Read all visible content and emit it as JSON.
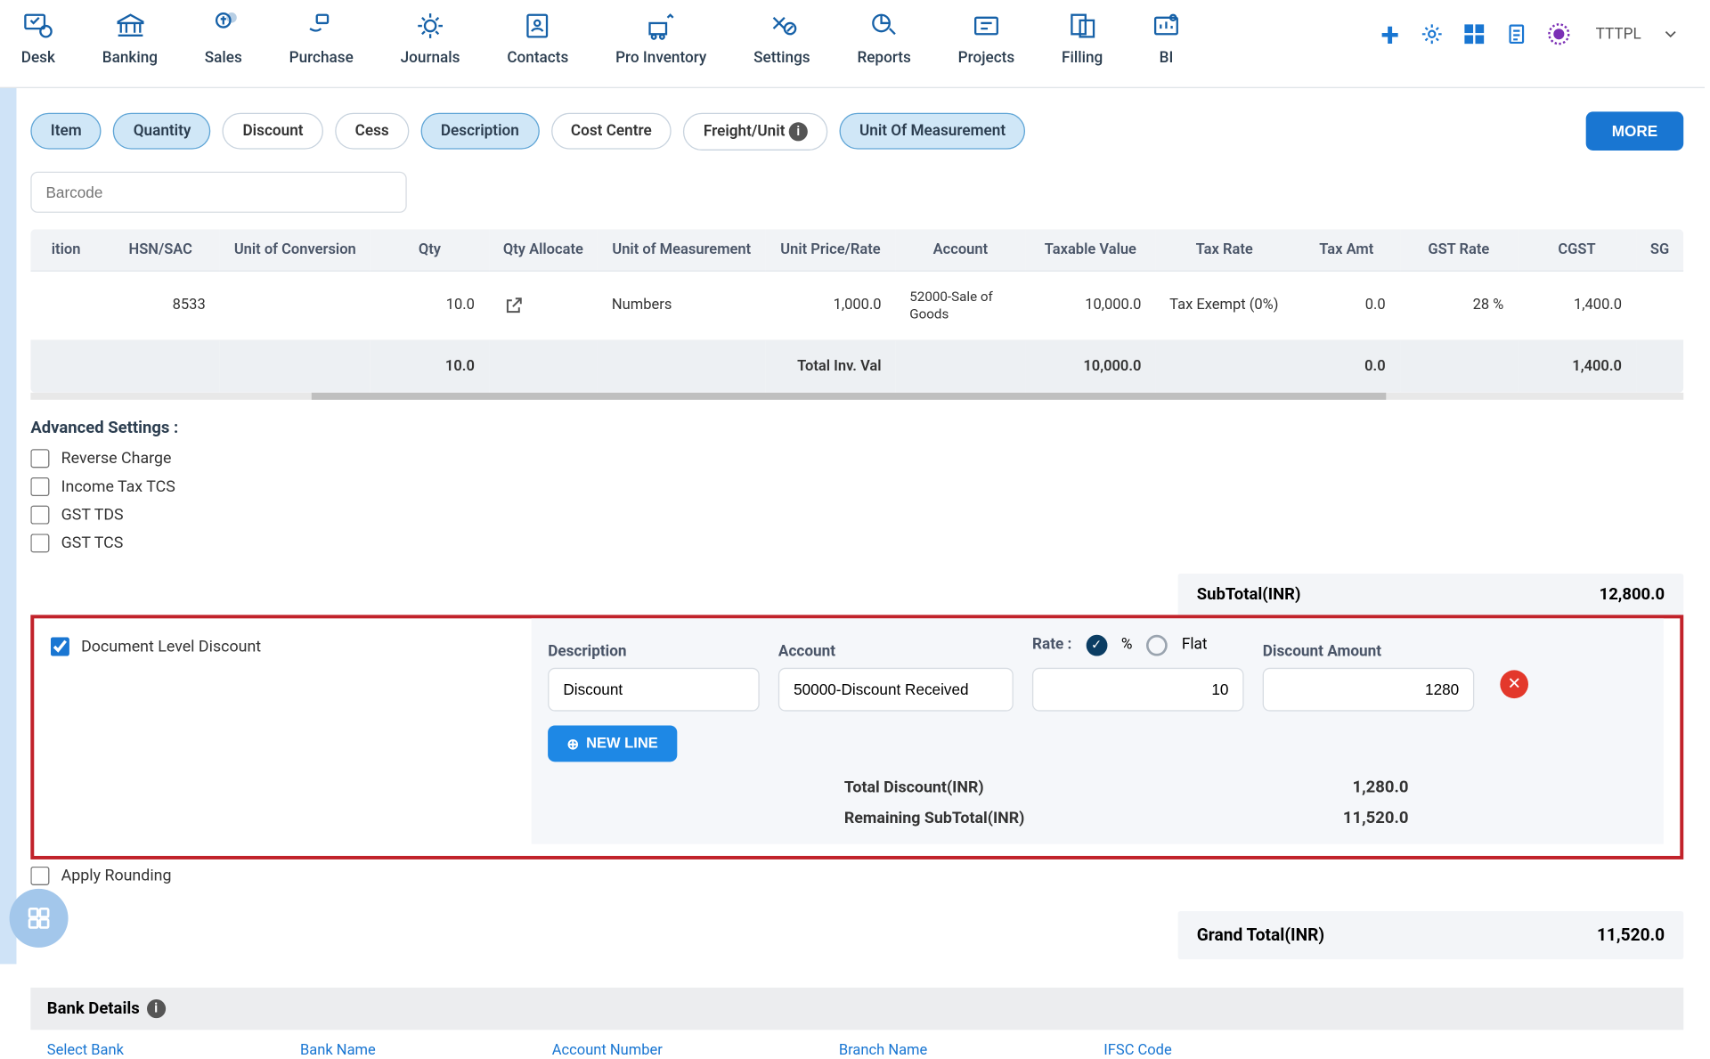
{
  "nav": [
    {
      "label": "Desk"
    },
    {
      "label": "Banking"
    },
    {
      "label": "Sales"
    },
    {
      "label": "Purchase"
    },
    {
      "label": "Journals"
    },
    {
      "label": "Contacts"
    },
    {
      "label": "Pro Inventory"
    },
    {
      "label": "Settings"
    },
    {
      "label": "Reports"
    },
    {
      "label": "Projects"
    },
    {
      "label": "Filling"
    },
    {
      "label": "BI"
    }
  ],
  "company_label": "TTTPL",
  "chips": {
    "item": "Item",
    "quantity": "Quantity",
    "discount": "Discount",
    "cess": "Cess",
    "description": "Description",
    "cost_centre": "Cost Centre",
    "freight": "Freight/Unit",
    "uom": "Unit Of Measurement"
  },
  "more_label": "MORE",
  "barcode_placeholder": "Barcode",
  "table": {
    "headers": {
      "ition": "ition",
      "hsn": "HSN/SAC",
      "uoc": "Unit of Conversion",
      "qty": "Qty",
      "qty_allocate": "Qty Allocate",
      "uom": "Unit of Measurement",
      "unit_price": "Unit Price/Rate",
      "account": "Account",
      "taxable": "Taxable Value",
      "tax_rate": "Tax Rate",
      "tax_amt": "Tax Amt",
      "gst_rate": "GST Rate",
      "cgst": "CGST",
      "sgst": "SG"
    },
    "row": {
      "hsn": "8533",
      "qty": "10.0",
      "uom": "Numbers",
      "unit_price": "1,000.0",
      "account": "52000-Sale of Goods",
      "taxable": "10,000.0",
      "tax_rate": "Tax Exempt (0%)",
      "tax_amt": "0.0",
      "gst_rate": "28 %",
      "cgst": "1,400.0"
    },
    "total": {
      "qty": "10.0",
      "label": "Total Inv. Val",
      "taxable": "10,000.0",
      "tax_amt": "0.0",
      "cgst": "1,400.0"
    }
  },
  "adv": {
    "title": "Advanced Settings :",
    "reverse": "Reverse Charge",
    "tcs": "Income Tax TCS",
    "gst_tds": "GST TDS",
    "gst_tcs": "GST TCS",
    "doc_discount": "Document Level Discount",
    "apply_rounding": "Apply Rounding"
  },
  "subtotal": {
    "label": "SubTotal(INR)",
    "value": "12,800.0"
  },
  "discount_panel": {
    "desc_label": "Description",
    "acct_label": "Account",
    "rate_label": "Rate :",
    "pct_label": "%",
    "flat_label": "Flat",
    "amt_label": "Discount Amount",
    "desc_value": "Discount",
    "acct_value": "50000-Discount Received",
    "rate_value": "10",
    "amt_value": "1280",
    "newline": "NEW LINE",
    "total_disc_label": "Total Discount(INR)",
    "total_disc_value": "1,280.0",
    "remaining_label": "Remaining SubTotal(INR)",
    "remaining_value": "11,520.0"
  },
  "grand": {
    "label": "Grand Total(INR)",
    "value": "11,520.0"
  },
  "bank": {
    "title": "Bank Details",
    "select": "Select Bank",
    "name": "Bank Name",
    "acct": "Account Number",
    "branch": "Branch Name",
    "ifsc": "IFSC Code"
  }
}
